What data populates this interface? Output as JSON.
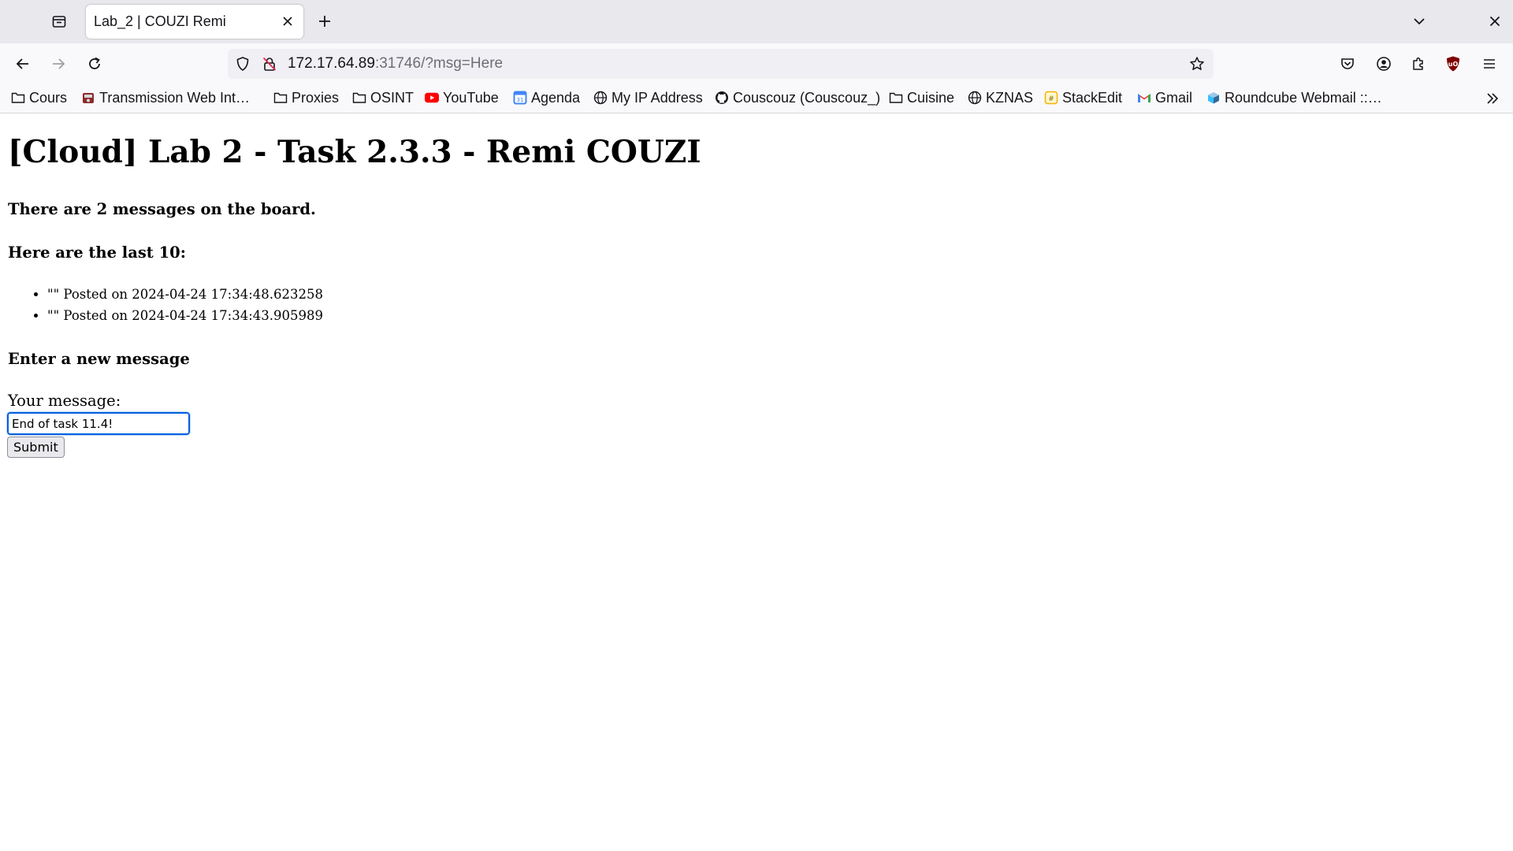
{
  "browser": {
    "tab": {
      "title": "Lab_2 | COUZI Remi"
    },
    "url": {
      "host": "172.17.64.89",
      "rest": ":31746/?msg=Here"
    },
    "bookmarks": [
      {
        "label": "Cours",
        "icon": "folder-icon"
      },
      {
        "label": "Transmission Web Int…",
        "icon": "transmission-icon"
      },
      {
        "label": "Proxies",
        "icon": "folder-icon"
      },
      {
        "label": "OSINT",
        "icon": "folder-icon"
      },
      {
        "label": "YouTube",
        "icon": "youtube-icon"
      },
      {
        "label": "Agenda",
        "icon": "calendar-icon"
      },
      {
        "label": "My IP Address",
        "icon": "globe-icon"
      },
      {
        "label": "Couscouz (Couscouz_)",
        "icon": "github-icon"
      },
      {
        "label": "Cuisine",
        "icon": "folder-icon"
      },
      {
        "label": "KZNAS",
        "icon": "globe-icon"
      },
      {
        "label": "StackEdit",
        "icon": "stackedit-icon"
      },
      {
        "label": "Gmail",
        "icon": "gmail-icon"
      },
      {
        "label": "Roundcube Webmail ::…",
        "icon": "roundcube-icon"
      }
    ]
  },
  "page": {
    "heading": "[Cloud] Lab 2 - Task 2.3.3 - Remi COUZI",
    "count_text": "There are 2 messages on the board.",
    "last_heading": "Here are the last 10:",
    "messages": [
      "\"\" Posted on 2024-04-24 17:34:48.623258",
      "\"\" Posted on 2024-04-24 17:34:43.905989"
    ],
    "new_heading": "Enter a new message",
    "form": {
      "label": "Your message:",
      "input_value": "End of task 11.4!",
      "submit_label": "Submit"
    }
  }
}
